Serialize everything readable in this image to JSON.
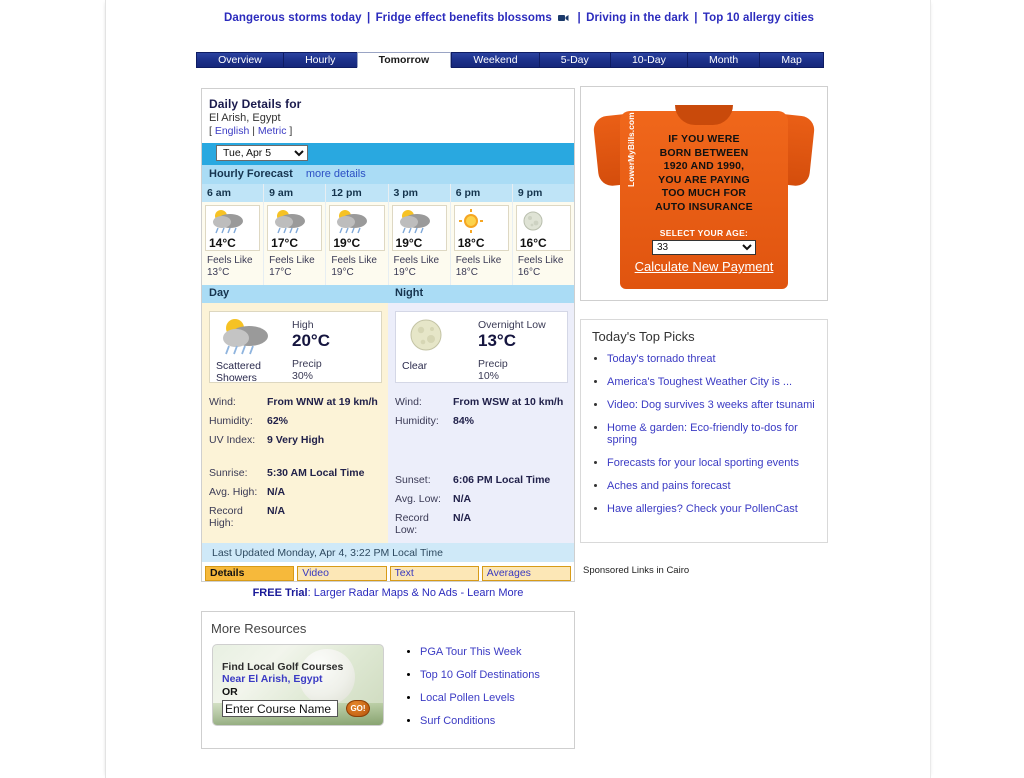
{
  "headlines": [
    {
      "text": "Dangerous storms today"
    },
    {
      "text": "Fridge effect benefits blossoms",
      "icon": "video-camera-icon"
    },
    {
      "text": "Driving in the dark"
    },
    {
      "text": "Top 10 allergy cities"
    }
  ],
  "separator": "|",
  "tabs": [
    {
      "label": "Overview",
      "active": false
    },
    {
      "label": "Hourly",
      "active": false
    },
    {
      "label": "Tomorrow",
      "active": true
    },
    {
      "label": "Weekend",
      "active": false
    },
    {
      "label": "5-Day",
      "active": false
    },
    {
      "label": "10-Day",
      "active": false
    },
    {
      "label": "Month",
      "active": false
    },
    {
      "label": "Map",
      "active": false
    }
  ],
  "daily_details": {
    "title": "Daily Details for",
    "location": "El Arish, Egypt",
    "units_prefix": "[",
    "units_english": "English",
    "units_divider": "|",
    "units_metric": "Metric",
    "units_suffix": "]",
    "date_selected": "Tue, Apr 5",
    "hourly_heading": "Hourly Forecast",
    "more_details": "more details"
  },
  "hourly": [
    {
      "time": "6 am",
      "icon": "sun-behind-rain-cloud-icon",
      "temp": "14°C",
      "feels_label": "Feels Like",
      "feels": "13°C"
    },
    {
      "time": "9 am",
      "icon": "sun-behind-rain-cloud-icon",
      "temp": "17°C",
      "feels_label": "Feels Like",
      "feels": "17°C"
    },
    {
      "time": "12 pm",
      "icon": "sun-behind-rain-cloud-icon",
      "temp": "19°C",
      "feels_label": "Feels Like",
      "feels": "19°C"
    },
    {
      "time": "3 pm",
      "icon": "sun-behind-rain-cloud-icon",
      "temp": "19°C",
      "feels_label": "Feels Like",
      "feels": "19°C"
    },
    {
      "time": "6 pm",
      "icon": "sun-icon",
      "temp": "18°C",
      "feels_label": "Feels Like",
      "feels": "18°C"
    },
    {
      "time": "9 pm",
      "icon": "moon-icon",
      "temp": "16°C",
      "feels_label": "Feels Like",
      "feels": "16°C"
    }
  ],
  "day": {
    "heading": "Day",
    "icon": "sun-behind-rain-cloud-icon",
    "condition": "Scattered Showers",
    "temp_label": "High",
    "temp": "20°C",
    "precip_label": "Precip",
    "precip": "30%",
    "stats": [
      {
        "key": "Wind:",
        "value": "From WNW at 19 km/h"
      },
      {
        "key": "Humidity:",
        "value": "62%"
      },
      {
        "key": "UV Index:",
        "value": "9 Very High"
      }
    ],
    "stats2": [
      {
        "key": "Sunrise:",
        "value": "5:30 AM Local Time"
      },
      {
        "key": "Avg. High:",
        "value": "N/A"
      },
      {
        "key": "Record High:",
        "value": "N/A"
      }
    ]
  },
  "night": {
    "heading": "Night",
    "icon": "moon-icon",
    "condition": "Clear",
    "temp_label": "Overnight Low",
    "temp": "13°C",
    "precip_label": "Precip",
    "precip": "10%",
    "stats": [
      {
        "key": "Wind:",
        "value": "From WSW at 10 km/h"
      },
      {
        "key": "Humidity:",
        "value": "84%"
      }
    ],
    "stats2": [
      {
        "key": "Sunset:",
        "value": "6:06 PM Local Time"
      },
      {
        "key": "Avg. Low:",
        "value": "N/A"
      },
      {
        "key": "Record Low:",
        "value": "N/A"
      }
    ]
  },
  "updated": "Last Updated Monday, Apr 4, 3:22 PM Local Time",
  "subtabs": [
    {
      "label": "Details",
      "active": true
    },
    {
      "label": "Video",
      "active": false
    },
    {
      "label": "Text",
      "active": false
    },
    {
      "label": "Averages",
      "active": false
    }
  ],
  "free_trial": {
    "bold": "FREE Trial",
    "rest": ": Larger Radar Maps & No Ads - Learn More"
  },
  "more_resources": {
    "title": "More Resources",
    "golf": {
      "line1": "Find Local Golf Courses",
      "near_label": "Near ",
      "near_location": "El Arish, Egypt",
      "or": "OR",
      "input_value": "Enter Course Name",
      "go_label": "GO!"
    },
    "links": [
      "PGA Tour This Week",
      "Top 10 Golf Destinations",
      "Local Pollen Levels",
      "Surf Conditions"
    ]
  },
  "ad": {
    "lines": [
      "IF YOU WERE",
      "BORN BETWEEN",
      "1920 AND 1990,",
      "YOU ARE PAYING",
      "TOO MUCH FOR",
      "AUTO INSURANCE"
    ],
    "select_label": "SELECT YOUR AGE:",
    "select_value": "33",
    "cta": "Calculate New Payment",
    "brand": "LowerMyBills.com"
  },
  "top_picks": {
    "title": "Today's Top Picks",
    "items": [
      "Today's tornado threat",
      "America's Toughest Weather City is ...",
      "Video: Dog survives 3 weeks after tsunami",
      "Home & garden: Eco-friendly to-dos for spring",
      "Forecasts for your local sporting events",
      "Aches and pains forecast",
      "Have allergies? Check your PollenCast"
    ]
  },
  "sponsored": "Sponsored Links in Cairo",
  "colors": {
    "tab_blue": "#1d328c",
    "accent_cyan": "#29a8e0",
    "link_blue": "#3b3bc4",
    "day_bg": "#fcf3d7",
    "night_bg": "#eceefa",
    "ad_orange": "#e0540f"
  }
}
